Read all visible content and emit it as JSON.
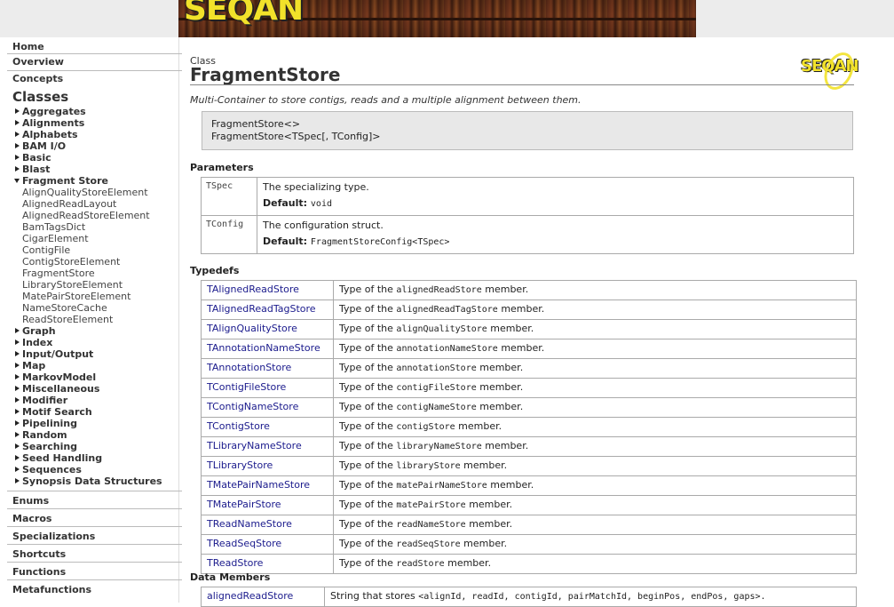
{
  "banner": {
    "logo_text": "SEQAN"
  },
  "sidebar": {
    "top_links": [
      "Home",
      "Overview",
      "Concepts"
    ],
    "classes_heading": "Classes",
    "groups": [
      {
        "label": "Aggregates",
        "open": false
      },
      {
        "label": "Alignments",
        "open": false
      },
      {
        "label": "Alphabets",
        "open": false
      },
      {
        "label": "BAM I/O",
        "open": false
      },
      {
        "label": "Basic",
        "open": false
      },
      {
        "label": "Blast",
        "open": false
      },
      {
        "label": "Fragment Store",
        "open": true
      },
      {
        "label": "Graph",
        "open": false
      },
      {
        "label": "Index",
        "open": false
      },
      {
        "label": "Input/Output",
        "open": false
      },
      {
        "label": "Map",
        "open": false
      },
      {
        "label": "MarkovModel",
        "open": false
      },
      {
        "label": "Miscellaneous",
        "open": false
      },
      {
        "label": "Modifier",
        "open": false
      },
      {
        "label": "Motif Search",
        "open": false
      },
      {
        "label": "Pipelining",
        "open": false
      },
      {
        "label": "Random",
        "open": false
      },
      {
        "label": "Searching",
        "open": false
      },
      {
        "label": "Seed Handling",
        "open": false
      },
      {
        "label": "Sequences",
        "open": false
      },
      {
        "label": "Synopsis Data Structures",
        "open": false
      }
    ],
    "fragment_store_items": [
      "AlignQualityStoreElement",
      "AlignedReadLayout",
      "AlignedReadStoreElement",
      "BamTagsDict",
      "CigarElement",
      "ContigFile",
      "ContigStoreElement",
      "FragmentStore",
      "LibraryStoreElement",
      "MatePairStoreElement",
      "NameStoreCache",
      "ReadStoreElement"
    ],
    "bottom_links": [
      "Enums",
      "Macros",
      "Specializations",
      "Shortcuts",
      "Functions",
      "Metafunctions"
    ]
  },
  "main": {
    "kind": "Class",
    "title": "FragmentStore",
    "logo_text": "SEQAN",
    "description": "Multi-Container to store contigs, reads and a multiple alignment between them.",
    "signatures": [
      "FragmentStore<>",
      "FragmentStore<TSpec[, TConfig]>"
    ],
    "parameters_heading": "Parameters",
    "default_label": "Default:",
    "parameters": [
      {
        "name": "TSpec",
        "desc": "The specializing type.",
        "default": "void"
      },
      {
        "name": "TConfig",
        "desc": "The configuration struct.",
        "default": "FragmentStoreConfig<TSpec>"
      }
    ],
    "typedefs_heading": "Typedefs",
    "typedef_prefix": "Type of the",
    "typedef_suffix": "member.",
    "typedefs": [
      {
        "name": "TAlignedReadStore",
        "member": "alignedReadStore"
      },
      {
        "name": "TAlignedReadTagStore",
        "member": "alignedReadTagStore"
      },
      {
        "name": "TAlignQualityStore",
        "member": "alignQualityStore"
      },
      {
        "name": "TAnnotationNameStore",
        "member": "annotationNameStore"
      },
      {
        "name": "TAnnotationStore",
        "member": "annotationStore"
      },
      {
        "name": "TContigFileStore",
        "member": "contigFileStore"
      },
      {
        "name": "TContigNameStore",
        "member": "contigNameStore"
      },
      {
        "name": "TContigStore",
        "member": "contigStore"
      },
      {
        "name": "TLibraryNameStore",
        "member": "libraryNameStore"
      },
      {
        "name": "TLibraryStore",
        "member": "libraryStore"
      },
      {
        "name": "TMatePairNameStore",
        "member": "matePairNameStore"
      },
      {
        "name": "TMatePairStore",
        "member": "matePairStore"
      },
      {
        "name": "TReadNameStore",
        "member": "readNameStore"
      },
      {
        "name": "TReadSeqStore",
        "member": "readSeqStore"
      },
      {
        "name": "TReadStore",
        "member": "readStore"
      }
    ],
    "data_members_heading": "Data Members",
    "data_members": [
      {
        "name": "alignedReadStore",
        "prefix": "String that stores",
        "code": "<alignId, readId, contigId, pairMatchId, beginPos, endPos, gaps>."
      }
    ]
  }
}
